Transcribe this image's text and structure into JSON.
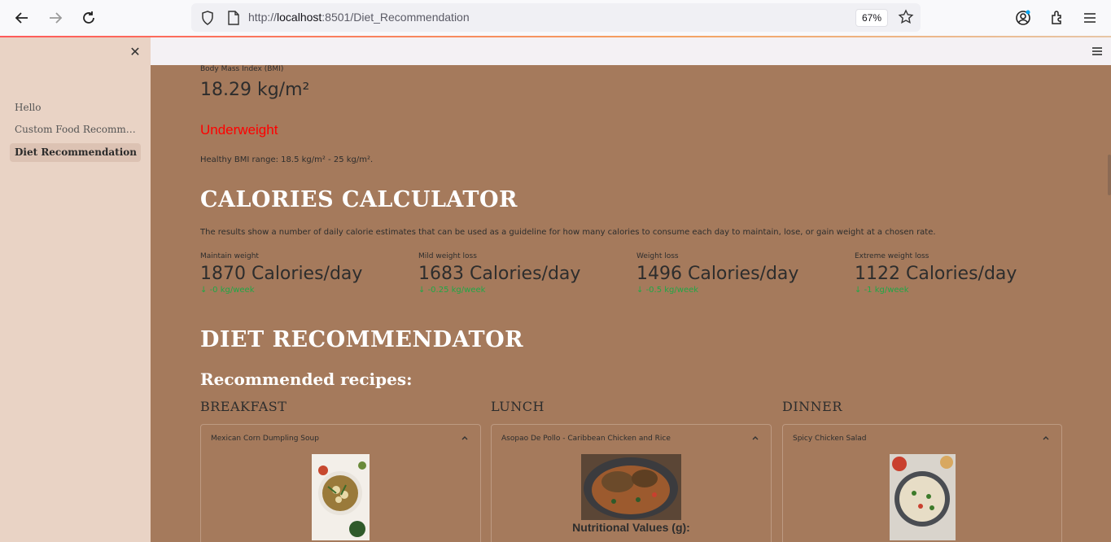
{
  "browser": {
    "url_prefix": "http://",
    "url_host": "localhost",
    "url_rest": ":8501/Diet_Recommendation",
    "zoom": "67%"
  },
  "sidebar": {
    "items": [
      {
        "label": "Hello",
        "active": false
      },
      {
        "label": "Custom Food Recommendation",
        "active": false
      },
      {
        "label": "Diet Recommendation",
        "active": true
      }
    ]
  },
  "bmi": {
    "label": "Body Mass Index (BMI)",
    "value": "18.29 kg/m²",
    "status": "Underweight",
    "status_color": "#ff0000",
    "range_note": "Healthy BMI range: 18.5 kg/m² - 25 kg/m²."
  },
  "calories": {
    "title": "CALORIES CALCULATOR",
    "description": "The results show a number of daily calorie estimates that can be used as a guideline for how many calories to consume each day to maintain, lose, or gain weight at a chosen rate.",
    "metrics": [
      {
        "label": "Maintain weight",
        "value": "1870 Calories/day",
        "delta": "-0 kg/week"
      },
      {
        "label": "Mild weight loss",
        "value": "1683 Calories/day",
        "delta": "-0.25 kg/week"
      },
      {
        "label": "Weight loss",
        "value": "1496 Calories/day",
        "delta": "-0.5 kg/week"
      },
      {
        "label": "Extreme weight loss",
        "value": "1122 Calories/day",
        "delta": "-1 kg/week"
      }
    ],
    "delta_color": "#1fa846"
  },
  "diet": {
    "title": "DIET RECOMMENDATOR",
    "subtitle": "Recommended recipes:",
    "meals": [
      {
        "heading": "BREAKFAST",
        "recipe": "Mexican Corn Dumpling Soup",
        "show_nutrition": false
      },
      {
        "heading": "LUNCH",
        "recipe": "Asopao De Pollo - Caribbean Chicken and Rice",
        "show_nutrition": true,
        "nutrition_label": "Nutritional Values (g):"
      },
      {
        "heading": "DINNER",
        "recipe": "Spicy Chicken Salad",
        "show_nutrition": false
      }
    ]
  },
  "icons": [
    "back-arrow-icon",
    "forward-arrow-icon",
    "reload-icon",
    "shield-icon",
    "page-icon",
    "star-icon",
    "account-icon",
    "extensions-icon",
    "menu-icon",
    "close-icon",
    "hamburger-icon",
    "chevron-up-icon",
    "arrow-down-icon"
  ]
}
